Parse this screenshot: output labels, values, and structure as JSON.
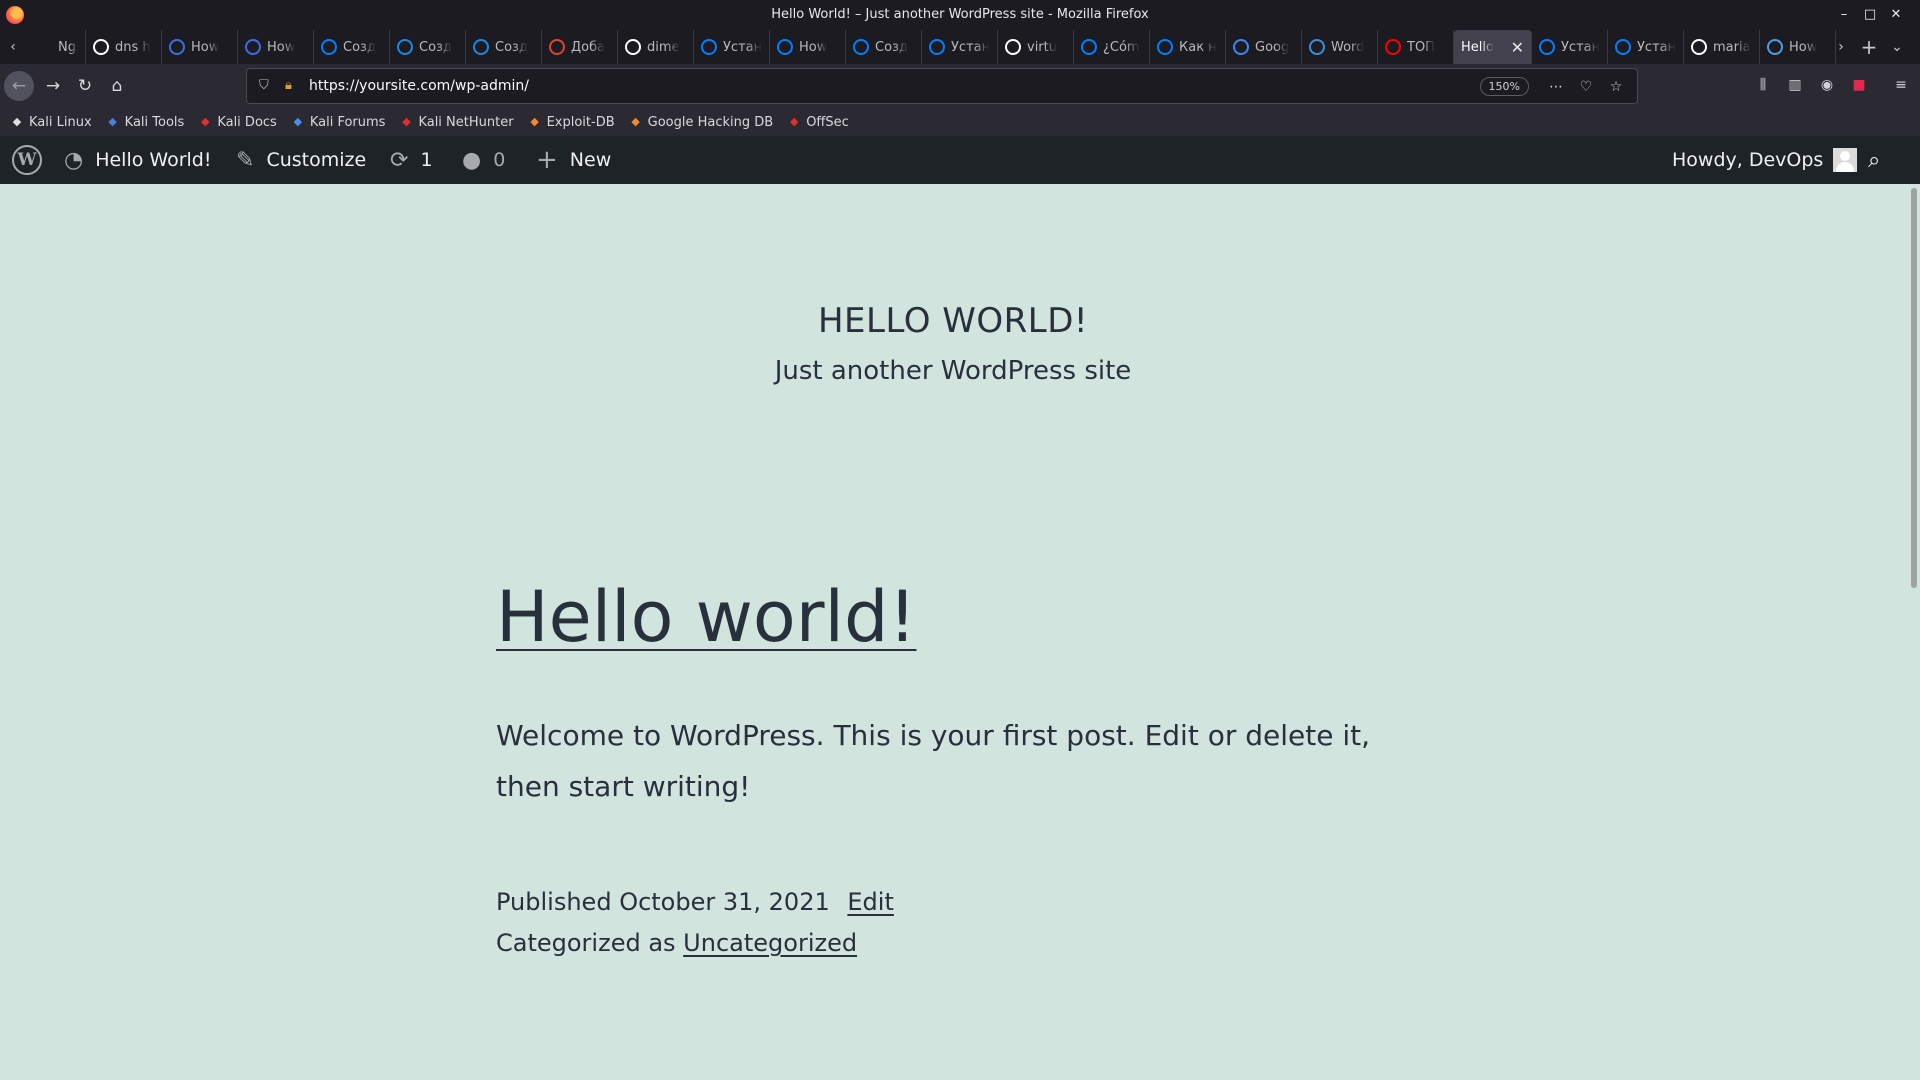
{
  "window": {
    "title": "Hello World! – Just another WordPress site - Mozilla Firefox"
  },
  "tabs": [
    {
      "label": "Ngin",
      "icon": "nginx-icon",
      "color": "#1c1b22"
    },
    {
      "label": "dns h",
      "icon": "google-icon",
      "color": "#ffffff"
    },
    {
      "label": "How",
      "icon": "howto-icon",
      "color": "#3d6ee0"
    },
    {
      "label": "How",
      "icon": "howto-icon",
      "color": "#3d6ee0"
    },
    {
      "label": "Созд",
      "icon": "digitalocean-icon",
      "color": "#0080ff"
    },
    {
      "label": "Созд",
      "icon": "b-icon",
      "color": "#1e88e5"
    },
    {
      "label": "Созд",
      "icon": "b-icon",
      "color": "#1e88e5"
    },
    {
      "label": "Доба",
      "icon": "bs-icon",
      "color": "#e0452b"
    },
    {
      "label": "dime",
      "icon": "github-icon",
      "color": "#ffffff"
    },
    {
      "label": "Устан",
      "icon": "digitalocean-icon",
      "color": "#0080ff"
    },
    {
      "label": "How",
      "icon": "digitalocean-icon",
      "color": "#0080ff"
    },
    {
      "label": "Созд",
      "icon": "digitalocean-icon",
      "color": "#0080ff"
    },
    {
      "label": "Устан",
      "icon": "digitalocean-icon",
      "color": "#0080ff"
    },
    {
      "label": "virtu",
      "icon": "google-icon",
      "color": "#ffffff"
    },
    {
      "label": "¿Cóm",
      "icon": "digitalocean-icon",
      "color": "#0080ff"
    },
    {
      "label": "Как н",
      "icon": "digitalocean-icon",
      "color": "#0080ff"
    },
    {
      "label": "Goog",
      "icon": "google-translate-icon",
      "color": "#4285f4"
    },
    {
      "label": "Word",
      "icon": "wordpress-icon",
      "color": "#3d8fd6"
    },
    {
      "label": "ТОП",
      "icon": "youtube-icon",
      "color": "#ff0000"
    },
    {
      "label": "Hello",
      "icon": "",
      "color": "",
      "active": true
    },
    {
      "label": "Устан",
      "icon": "digitalocean-icon",
      "color": "#0080ff"
    },
    {
      "label": "Устан",
      "icon": "digitalocean-icon",
      "color": "#0080ff"
    },
    {
      "label": "maria",
      "icon": "google-icon",
      "color": "#ffffff"
    },
    {
      "label": "How",
      "icon": "box-icon",
      "color": "#4d9de0"
    }
  ],
  "nav": {
    "url": "https://yoursite.com/wp-admin/",
    "zoom": "150%"
  },
  "bookmarks": [
    {
      "label": "Kali Linux",
      "icon": "kali-linux-icon",
      "color": "#e0e0e0"
    },
    {
      "label": "Kali Tools",
      "icon": "kali-tools-icon",
      "color": "#4a7fe0"
    },
    {
      "label": "Kali Docs",
      "icon": "kali-docs-icon",
      "color": "#e0302b"
    },
    {
      "label": "Kali Forums",
      "icon": "kali-forums-icon",
      "color": "#4a90e2"
    },
    {
      "label": "Kali NetHunter",
      "icon": "kali-nethunter-icon",
      "color": "#e0302b"
    },
    {
      "label": "Exploit-DB",
      "icon": "exploit-db-icon",
      "color": "#f28a2e"
    },
    {
      "label": "Google Hacking DB",
      "icon": "google-hacking-db-icon",
      "color": "#f28a2e"
    },
    {
      "label": "OffSec",
      "icon": "offsec-icon",
      "color": "#e0302b"
    }
  ],
  "adminbar": {
    "site_name": "Hello World!",
    "customize": "Customize",
    "updates_count": "1",
    "comments_count": "0",
    "new_label": "New",
    "howdy": "Howdy, DevOps"
  },
  "site": {
    "title": "HELLO WORLD!",
    "description": "Just another WordPress site"
  },
  "post": {
    "title": "Hello world!",
    "body": "Welcome to WordPress. This is your first post. Edit or delete it, then start writing!",
    "published_label": "Published",
    "date": "October 31, 2021",
    "edit_label": "Edit",
    "categorized_label": "Categorized as",
    "category": "Uncategorized"
  }
}
